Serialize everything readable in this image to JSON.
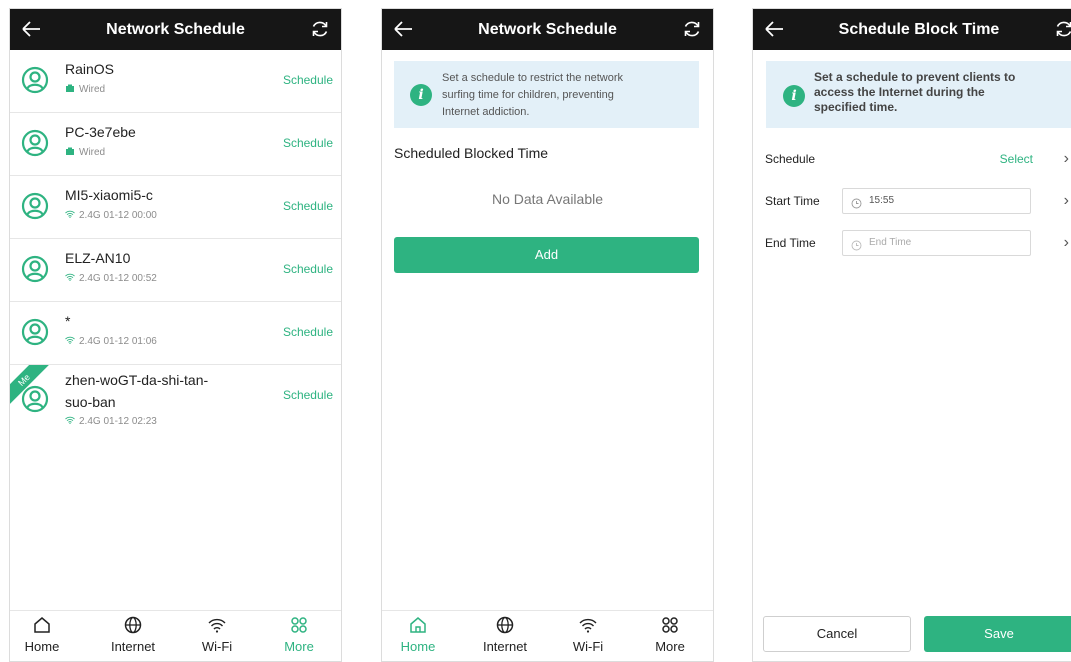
{
  "colors": {
    "accent": "#2eb381",
    "header": "#161616",
    "notice_bg": "#e3f0f8"
  },
  "screen1": {
    "title": "Network Schedule",
    "devices": [
      {
        "name": "RainOS",
        "conn_icon": "wired-icon",
        "sub": "Wired",
        "action": "Schedule"
      },
      {
        "name": "PC-3e7ebe",
        "conn_icon": "wired-icon",
        "sub": "Wired",
        "action": "Schedule"
      },
      {
        "name": "MI5-xiaomi5-c",
        "conn_icon": "wifi-icon",
        "sub": "2.4G 01-12 00:00",
        "action": "Schedule"
      },
      {
        "name": "ELZ-AN10",
        "conn_icon": "wifi-icon",
        "sub": "2.4G 01-12 00:52",
        "action": "Schedule"
      },
      {
        "name": "*",
        "conn_icon": "wifi-icon",
        "sub": "2.4G 01-12 01:06",
        "action": "Schedule"
      },
      {
        "name_line1": "zhen-woGT-da-shi-tan-",
        "name_line2": "suo-ban",
        "conn_icon": "wifi-icon",
        "sub": "2.4G 01-12 02:23",
        "action": "Schedule",
        "badge": "Me"
      }
    ],
    "tabs": [
      {
        "label": "Home",
        "icon": "home-icon"
      },
      {
        "label": "Internet",
        "icon": "globe-icon"
      },
      {
        "label": "Wi-Fi",
        "icon": "wifi-icon"
      },
      {
        "label": "More",
        "icon": "more-icon",
        "active": true
      }
    ]
  },
  "screen2": {
    "title": "Network Schedule",
    "notice_line1": "Set a schedule to restrict the network",
    "notice_line2": "surfing time for children, preventing",
    "notice_line3": "Internet addiction.",
    "section_title": "Scheduled Blocked Time",
    "empty_text": "No Data Available",
    "add_label": "Add",
    "tabs": [
      {
        "label": "Home",
        "icon": "home-icon",
        "active": true
      },
      {
        "label": "Internet",
        "icon": "globe-icon"
      },
      {
        "label": "Wi-Fi",
        "icon": "wifi-icon"
      },
      {
        "label": "More",
        "icon": "more-icon"
      }
    ]
  },
  "screen3": {
    "title": "Schedule Block Time",
    "notice_line1": "Set a schedule to prevent clients to",
    "notice_line2": "access the Internet during the",
    "notice_line3": "specified time.",
    "schedule_label": "Schedule",
    "schedule_value": "Select",
    "start_label": "Start Time",
    "start_value": "15:55",
    "end_label": "End Time",
    "end_placeholder": "End Time",
    "cancel_label": "Cancel",
    "save_label": "Save"
  }
}
